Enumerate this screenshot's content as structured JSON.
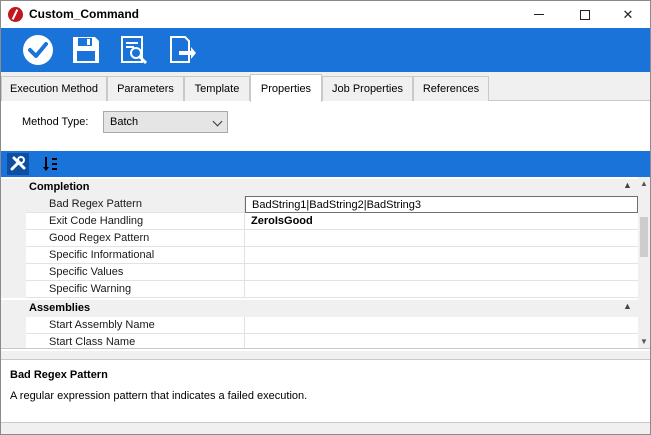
{
  "window": {
    "title": "Custom_Command",
    "controls": {
      "minimize": "minimize",
      "maximize": "maximize",
      "close": "✕"
    }
  },
  "toolbar": {
    "buttons": [
      {
        "icon": "checkmark-icon",
        "label": "Save and close"
      },
      {
        "icon": "save-icon",
        "label": "Save"
      },
      {
        "icon": "preview-icon",
        "label": "Preview"
      },
      {
        "icon": "export-icon",
        "label": "Export"
      }
    ],
    "color": "#1a73d9"
  },
  "tabs": [
    {
      "label": "Execution Method",
      "active": false
    },
    {
      "label": "Parameters",
      "active": false
    },
    {
      "label": "Template",
      "active": false
    },
    {
      "label": "Properties",
      "active": true
    },
    {
      "label": "Job Properties",
      "active": false
    },
    {
      "label": "References",
      "active": false
    }
  ],
  "method": {
    "label": "Method Type:",
    "value": "Batch"
  },
  "property_grid": {
    "toolbar_buttons": [
      "categorized-icon",
      "sort-alpha-icon"
    ],
    "categories": [
      {
        "name": "Completion",
        "properties": [
          {
            "name": "Bad Regex Pattern",
            "value": "BadString1|BadString2|BadString3",
            "selected": true,
            "bold": false
          },
          {
            "name": "Exit Code Handling",
            "value": "ZeroIsGood",
            "selected": false,
            "bold": true
          },
          {
            "name": "Good Regex Pattern",
            "value": "",
            "selected": false,
            "bold": false
          },
          {
            "name": "Specific Informational",
            "value": "",
            "selected": false,
            "bold": false
          },
          {
            "name": "Specific Values",
            "value": "",
            "selected": false,
            "bold": false
          },
          {
            "name": "Specific Warning",
            "value": "",
            "selected": false,
            "bold": false
          }
        ]
      },
      {
        "name": "Assemblies",
        "properties": [
          {
            "name": "Start Assembly Name",
            "value": "",
            "selected": false,
            "bold": false
          },
          {
            "name": "Start Class Name",
            "value": "",
            "selected": false,
            "bold": false
          }
        ]
      }
    ]
  },
  "description": {
    "title": "Bad Regex Pattern",
    "text": "A regular expression pattern that indicates a failed execution."
  }
}
